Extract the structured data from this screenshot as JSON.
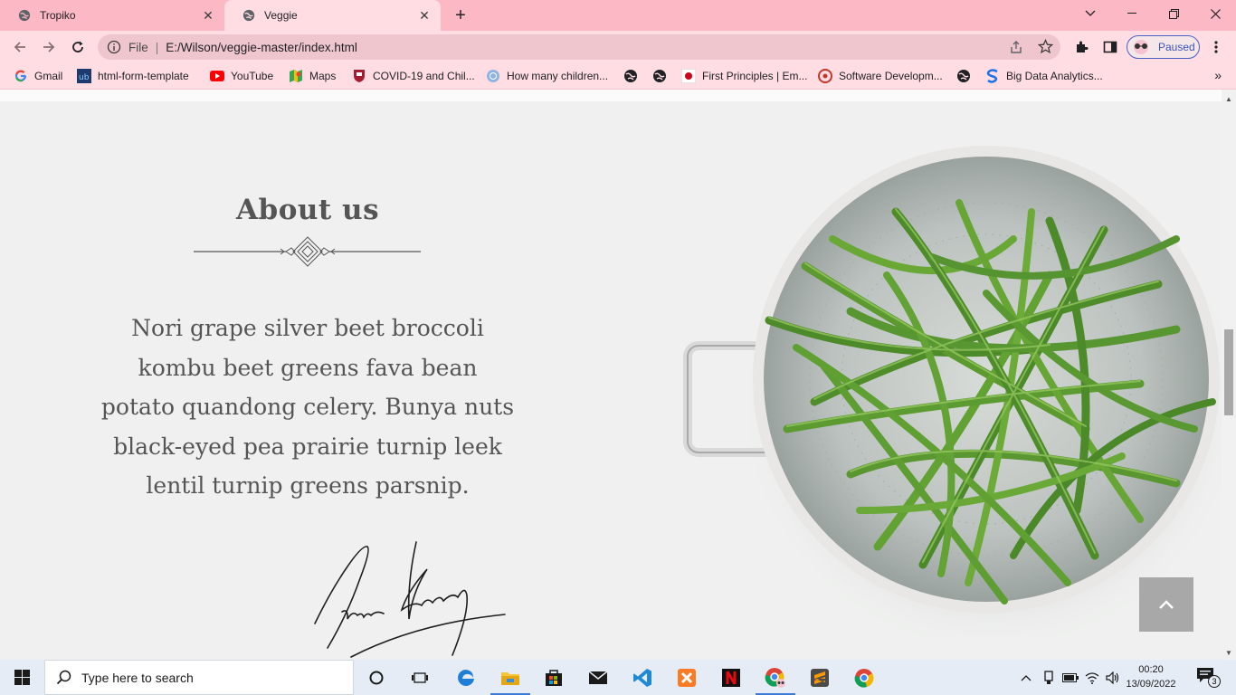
{
  "browser": {
    "tabs": [
      {
        "title": "Tropiko",
        "active": false
      },
      {
        "title": "Veggie",
        "active": true
      }
    ],
    "new_tab_label": "+",
    "window_controls": {
      "minimize": "—",
      "restore": "❐",
      "close": "✕",
      "tab_search": "⌄"
    },
    "address": {
      "scheme_label": "File",
      "separator": "|",
      "url": "E:/Wilson/veggie-master/index.html"
    },
    "profile": {
      "status": "Paused"
    },
    "bookmarks": [
      {
        "label": "Gmail",
        "icon": "gmail-icon"
      },
      {
        "label": "html-form-template",
        "icon": "ub-icon"
      },
      {
        "label": "YouTube",
        "icon": "youtube-icon"
      },
      {
        "label": "Maps",
        "icon": "maps-icon"
      },
      {
        "label": "COVID-19 and Chil...",
        "icon": "harvard-shield-icon"
      },
      {
        "label": "How many children...",
        "icon": "un-icon"
      },
      {
        "label": "",
        "icon": "globe-icon"
      },
      {
        "label": "",
        "icon": "globe-icon"
      },
      {
        "label": "First Principles | Em...",
        "icon": "first-principles-icon"
      },
      {
        "label": "Software Developm...",
        "icon": "software-icon"
      },
      {
        "label": "",
        "icon": "globe-icon"
      },
      {
        "label": "Big Data Analytics...",
        "icon": "s-logo-icon"
      }
    ],
    "bookmarks_more": "»"
  },
  "page": {
    "about": {
      "title": "About us",
      "text": "Nori grape silver beet broccoli kombu beet greens fava bean potato quandong celery. Bunya nuts black-eyed pea prairie turnip leek lentil turnip greens parsnip."
    },
    "back_to_top_icon": "chevron-up-icon"
  },
  "taskbar": {
    "search_placeholder": "Type here to search",
    "apps": [
      "cortana-icon",
      "task-view-icon",
      "edge-icon",
      "file-explorer-icon",
      "store-icon",
      "mail-icon",
      "vscode-icon",
      "xampp-icon",
      "netflix-icon",
      "chrome-profile-icon",
      "sublime-icon",
      "chrome-icon"
    ],
    "clock": {
      "time": "00:20",
      "date": "13/09/2022"
    },
    "notifications_count": "3"
  },
  "colors": {
    "tabstrip": "#fdb8c5",
    "toolbar": "#ffdde3",
    "page_bg": "#eff0ef",
    "text": "#555555",
    "taskbar": "#e6ecf5"
  }
}
